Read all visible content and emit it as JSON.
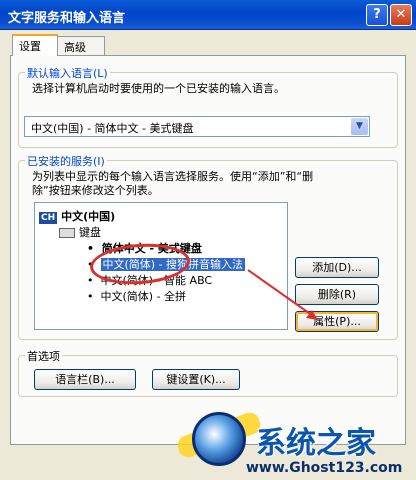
{
  "window": {
    "title": "文字服务和输入语言",
    "help_label": "?",
    "close_label": "✕"
  },
  "tabs": [
    {
      "label": "设置",
      "active": true
    },
    {
      "label": "高级",
      "active": false
    }
  ],
  "default_language": {
    "group_label": "默认输入语言(L)",
    "description": "选择计算机启动时要使用的一个已安装的输入语言。",
    "selected": "中文(中国) - 简体中文 - 美式键盘"
  },
  "installed_services": {
    "group_label": "已安装的服务(I)",
    "description_line1": "为列表中显示的每个输入语言选择服务。使用“添加”和“删",
    "description_line2": "除”按钮来修改这个列表。",
    "language_badge": "CH",
    "language": "中文(中国)",
    "category": "键盘",
    "items": [
      {
        "label": "简体中文 - 美式键盘",
        "bold": true,
        "selected": false
      },
      {
        "label": "中文(简体) - 搜狗拼音输入法",
        "bold": false,
        "selected": true
      },
      {
        "label": "中文(简体) - 智能 ABC",
        "bold": false,
        "selected": false
      },
      {
        "label": "中文(简体) - 全拼",
        "bold": false,
        "selected": false
      }
    ],
    "bullet": "•",
    "buttons": {
      "add": "添加(D)...",
      "remove": "删除(R)",
      "properties": "属性(P)..."
    }
  },
  "preferences": {
    "group_label": "首选项",
    "buttons": {
      "language_bar": "语言栏(B)...",
      "key_settings": "键设置(K)..."
    }
  },
  "watermark": {
    "brand": "系统之家",
    "url": "www.Ghost123.com"
  },
  "colors": {
    "title_bar": "#0045c8",
    "group_label": "#0046d5",
    "selection": "#316ac5",
    "annotation": "#d9302b"
  },
  "icons": [
    "help-icon",
    "close-icon",
    "dropdown-arrow-icon",
    "keyboard-icon",
    "language-badge-icon",
    "logo-icon"
  ]
}
